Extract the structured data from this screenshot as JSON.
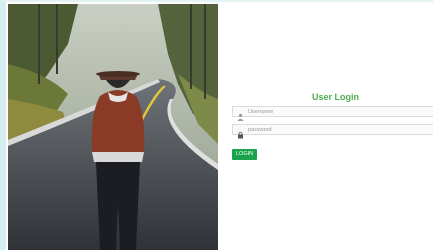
{
  "login": {
    "title": "User Login",
    "username_placeholder": "Username",
    "password_placeholder": "password",
    "button_label": "LOGIN"
  },
  "icons": {
    "username_icon": "user-icon",
    "password_icon": "lock-icon"
  },
  "colors": {
    "title": "#4caf50",
    "button": "#1aa34a"
  }
}
